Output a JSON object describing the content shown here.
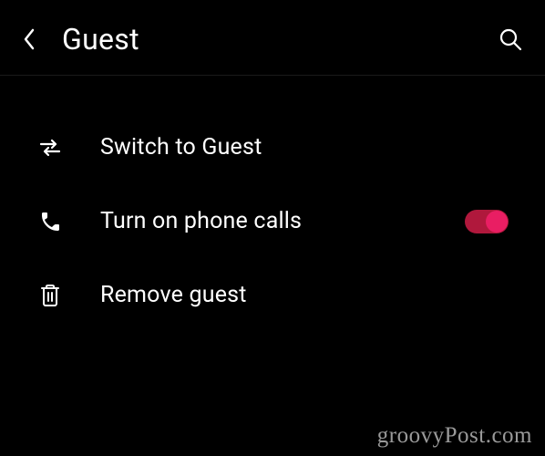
{
  "header": {
    "title": "Guest"
  },
  "items": [
    {
      "label": "Switch to Guest"
    },
    {
      "label": "Turn on phone calls"
    },
    {
      "label": "Remove guest"
    }
  ],
  "phone_calls_toggle": true,
  "watermark": "groovyPost.com"
}
